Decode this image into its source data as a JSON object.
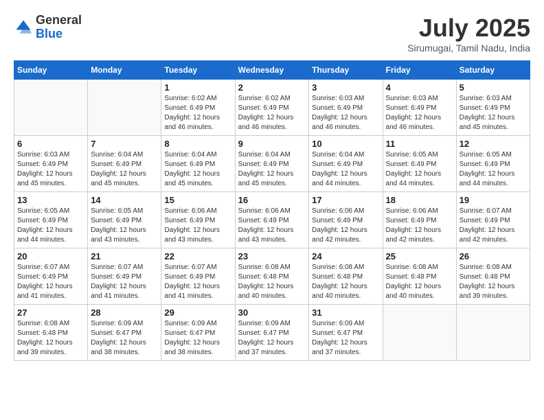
{
  "header": {
    "logo_general": "General",
    "logo_blue": "Blue",
    "month_title": "July 2025",
    "location": "Sirumugai, Tamil Nadu, India"
  },
  "days_of_week": [
    "Sunday",
    "Monday",
    "Tuesday",
    "Wednesday",
    "Thursday",
    "Friday",
    "Saturday"
  ],
  "weeks": [
    [
      {
        "day": "",
        "info": ""
      },
      {
        "day": "",
        "info": ""
      },
      {
        "day": "1",
        "info": "Sunrise: 6:02 AM\nSunset: 6:49 PM\nDaylight: 12 hours and 46 minutes."
      },
      {
        "day": "2",
        "info": "Sunrise: 6:02 AM\nSunset: 6:49 PM\nDaylight: 12 hours and 46 minutes."
      },
      {
        "day": "3",
        "info": "Sunrise: 6:03 AM\nSunset: 6:49 PM\nDaylight: 12 hours and 46 minutes."
      },
      {
        "day": "4",
        "info": "Sunrise: 6:03 AM\nSunset: 6:49 PM\nDaylight: 12 hours and 46 minutes."
      },
      {
        "day": "5",
        "info": "Sunrise: 6:03 AM\nSunset: 6:49 PM\nDaylight: 12 hours and 45 minutes."
      }
    ],
    [
      {
        "day": "6",
        "info": "Sunrise: 6:03 AM\nSunset: 6:49 PM\nDaylight: 12 hours and 45 minutes."
      },
      {
        "day": "7",
        "info": "Sunrise: 6:04 AM\nSunset: 6:49 PM\nDaylight: 12 hours and 45 minutes."
      },
      {
        "day": "8",
        "info": "Sunrise: 6:04 AM\nSunset: 6:49 PM\nDaylight: 12 hours and 45 minutes."
      },
      {
        "day": "9",
        "info": "Sunrise: 6:04 AM\nSunset: 6:49 PM\nDaylight: 12 hours and 45 minutes."
      },
      {
        "day": "10",
        "info": "Sunrise: 6:04 AM\nSunset: 6:49 PM\nDaylight: 12 hours and 44 minutes."
      },
      {
        "day": "11",
        "info": "Sunrise: 6:05 AM\nSunset: 6:49 PM\nDaylight: 12 hours and 44 minutes."
      },
      {
        "day": "12",
        "info": "Sunrise: 6:05 AM\nSunset: 6:49 PM\nDaylight: 12 hours and 44 minutes."
      }
    ],
    [
      {
        "day": "13",
        "info": "Sunrise: 6:05 AM\nSunset: 6:49 PM\nDaylight: 12 hours and 44 minutes."
      },
      {
        "day": "14",
        "info": "Sunrise: 6:05 AM\nSunset: 6:49 PM\nDaylight: 12 hours and 43 minutes."
      },
      {
        "day": "15",
        "info": "Sunrise: 6:06 AM\nSunset: 6:49 PM\nDaylight: 12 hours and 43 minutes."
      },
      {
        "day": "16",
        "info": "Sunrise: 6:06 AM\nSunset: 6:49 PM\nDaylight: 12 hours and 43 minutes."
      },
      {
        "day": "17",
        "info": "Sunrise: 6:06 AM\nSunset: 6:49 PM\nDaylight: 12 hours and 42 minutes."
      },
      {
        "day": "18",
        "info": "Sunrise: 6:06 AM\nSunset: 6:49 PM\nDaylight: 12 hours and 42 minutes."
      },
      {
        "day": "19",
        "info": "Sunrise: 6:07 AM\nSunset: 6:49 PM\nDaylight: 12 hours and 42 minutes."
      }
    ],
    [
      {
        "day": "20",
        "info": "Sunrise: 6:07 AM\nSunset: 6:49 PM\nDaylight: 12 hours and 41 minutes."
      },
      {
        "day": "21",
        "info": "Sunrise: 6:07 AM\nSunset: 6:49 PM\nDaylight: 12 hours and 41 minutes."
      },
      {
        "day": "22",
        "info": "Sunrise: 6:07 AM\nSunset: 6:49 PM\nDaylight: 12 hours and 41 minutes."
      },
      {
        "day": "23",
        "info": "Sunrise: 6:08 AM\nSunset: 6:48 PM\nDaylight: 12 hours and 40 minutes."
      },
      {
        "day": "24",
        "info": "Sunrise: 6:08 AM\nSunset: 6:48 PM\nDaylight: 12 hours and 40 minutes."
      },
      {
        "day": "25",
        "info": "Sunrise: 6:08 AM\nSunset: 6:48 PM\nDaylight: 12 hours and 40 minutes."
      },
      {
        "day": "26",
        "info": "Sunrise: 6:08 AM\nSunset: 6:48 PM\nDaylight: 12 hours and 39 minutes."
      }
    ],
    [
      {
        "day": "27",
        "info": "Sunrise: 6:08 AM\nSunset: 6:48 PM\nDaylight: 12 hours and 39 minutes."
      },
      {
        "day": "28",
        "info": "Sunrise: 6:09 AM\nSunset: 6:47 PM\nDaylight: 12 hours and 38 minutes."
      },
      {
        "day": "29",
        "info": "Sunrise: 6:09 AM\nSunset: 6:47 PM\nDaylight: 12 hours and 38 minutes."
      },
      {
        "day": "30",
        "info": "Sunrise: 6:09 AM\nSunset: 6:47 PM\nDaylight: 12 hours and 37 minutes."
      },
      {
        "day": "31",
        "info": "Sunrise: 6:09 AM\nSunset: 6:47 PM\nDaylight: 12 hours and 37 minutes."
      },
      {
        "day": "",
        "info": ""
      },
      {
        "day": "",
        "info": ""
      }
    ]
  ]
}
